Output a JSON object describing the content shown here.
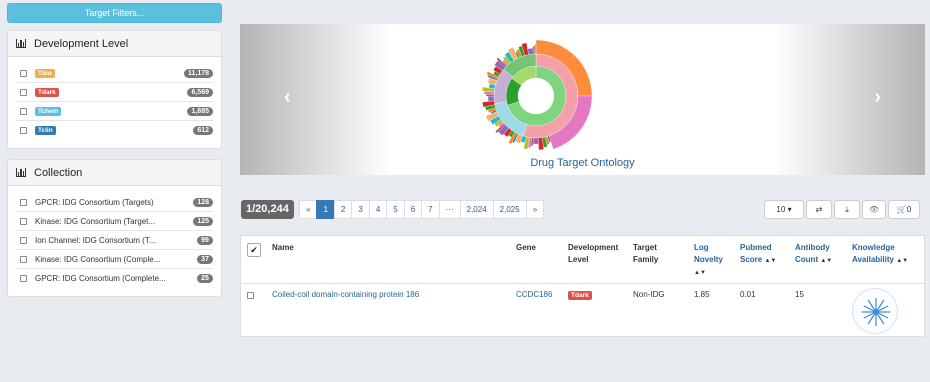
{
  "filters_button": "Target Filters...",
  "dev_panel": {
    "title": "Development Level",
    "items": [
      {
        "label": "Tbio",
        "count": "11,178",
        "color": "#f0ad4e"
      },
      {
        "label": "Tdark",
        "count": "6,569",
        "color": "#d9534f"
      },
      {
        "label": "Tchem",
        "count": "1,885",
        "color": "#5bc0de"
      },
      {
        "label": "Tclin",
        "count": "612",
        "color": "#337ab7"
      }
    ]
  },
  "collection_panel": {
    "title": "Collection",
    "items": [
      {
        "label": "GPCR: IDG Consortium (Targets)",
        "count": "128"
      },
      {
        "label": "Kinase: IDG Consortium (Target...",
        "count": "125"
      },
      {
        "label": "Ion Channel: IDG Consortium (T...",
        "count": "99"
      },
      {
        "label": "Kinase: IDG Consortium (Comple...",
        "count": "37"
      },
      {
        "label": "GPCR: IDG Consortium (Complete...",
        "count": "25"
      }
    ]
  },
  "carousel": {
    "title": "Drug Target Ontology",
    "prev_icon": "chevron-left-icon",
    "next_icon": "chevron-right-icon"
  },
  "pager": {
    "total": "1/20,244",
    "prev": "«",
    "pages": [
      "1",
      "2",
      "3",
      "4",
      "5",
      "6",
      "7",
      "···",
      "2,024",
      "2,025"
    ],
    "next": "»",
    "active": "1"
  },
  "tools": {
    "page_size": "10",
    "cart_count": "0"
  },
  "table": {
    "headers": {
      "name": "Name",
      "gene": "Gene",
      "dev_level": [
        "Development",
        "Level"
      ],
      "family": [
        "Target",
        "Family"
      ],
      "novelty": [
        "Log",
        "Novelty"
      ],
      "pubmed": [
        "Pubmed",
        "Score"
      ],
      "antibody": [
        "Antibody",
        "Count"
      ],
      "knowledge": [
        "Knowledge",
        "Availability"
      ]
    },
    "rows": [
      {
        "name": "Coiled-coil domain-containing protein 186",
        "gene": "CCDC186",
        "dev_level": "Tdark",
        "family": "Non-IDG",
        "novelty": "1.85",
        "pubmed": "0.01",
        "antibody": "15"
      }
    ]
  },
  "colors": {
    "accent": "#337ab7",
    "info": "#5bc0de",
    "tdark": "#d9534f"
  }
}
